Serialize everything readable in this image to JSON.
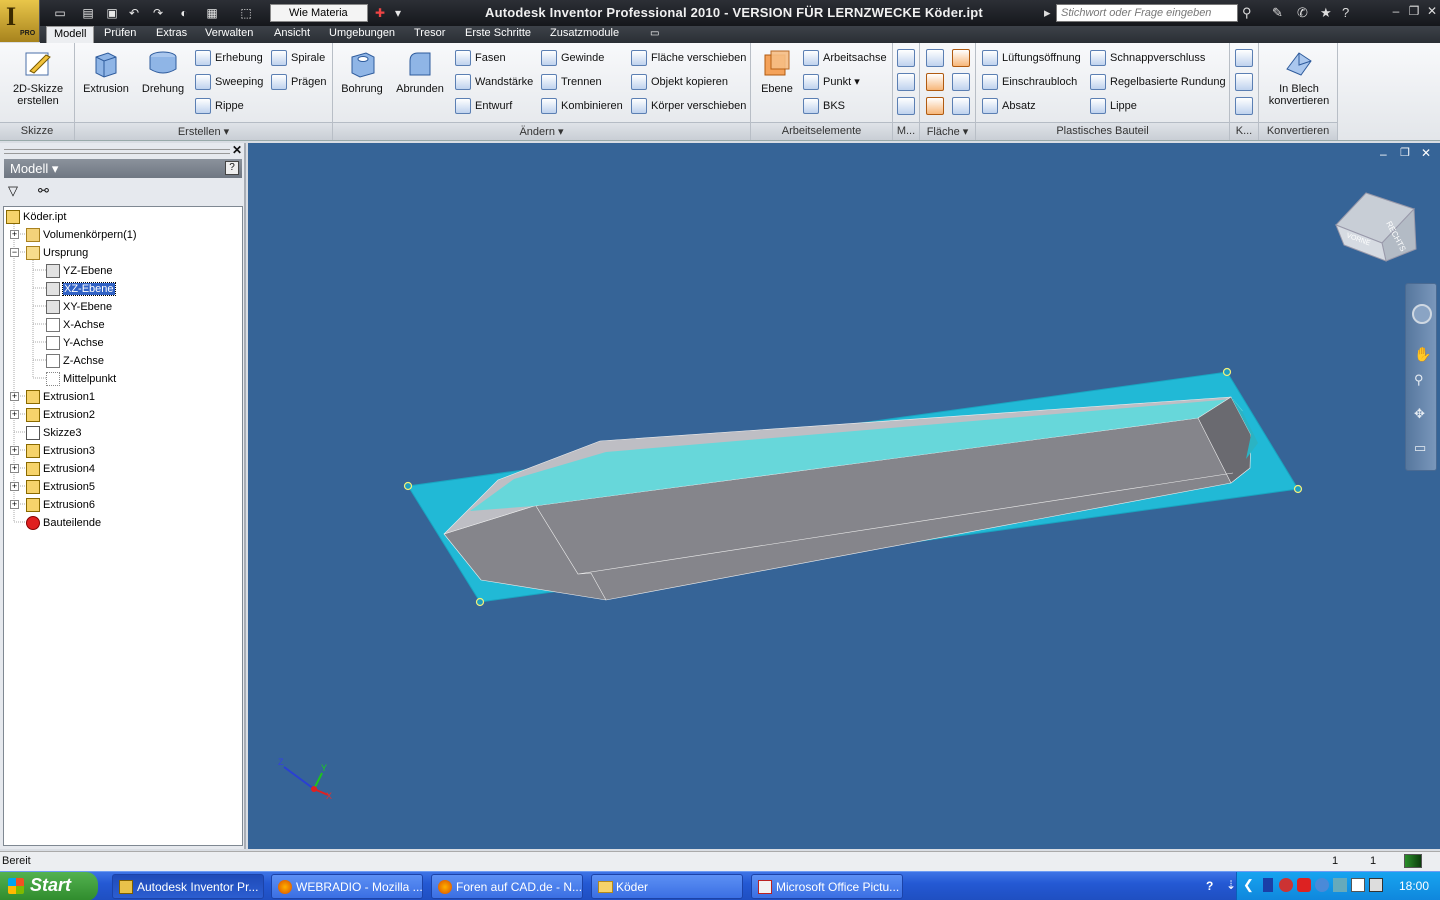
{
  "app": {
    "title": "Autodesk Inventor Professional 2010 - VERSION FÜR LERNZWECKE    Köder.ipt",
    "logo_letter": "I",
    "logo_badge": "PRO",
    "appearance": "Wie Materia",
    "search_placeholder": "Stichwort oder Frage eingeben"
  },
  "tabs": [
    "Modell",
    "Prüfen",
    "Extras",
    "Verwalten",
    "Ansicht",
    "Umgebungen",
    "Tresor",
    "Erste Schritte",
    "Zusatzmodule"
  ],
  "ribbon": {
    "skizze": {
      "button": "2D-Skizze erstellen",
      "title": "Skizze"
    },
    "erstellen": {
      "title": "Erstellen",
      "big": [
        "Extrusion",
        "Drehung"
      ],
      "small": [
        "Erhebung",
        "Sweeping",
        "Rippe",
        "Spirale",
        "Prägen"
      ]
    },
    "aendern": {
      "title": "Ändern",
      "big": [
        "Bohrung",
        "Abrunden"
      ],
      "small": [
        "Fasen",
        "Wandstärke",
        "Entwurf",
        "Gewinde",
        "Trennen",
        "Kombinieren",
        "Fläche verschieben",
        "Objekt kopieren",
        "Körper verschieben"
      ]
    },
    "arbeitselemente": {
      "title": "Arbeitselemente",
      "big": "Ebene",
      "small": [
        "Arbeitsachse",
        "Punkt",
        "BKS"
      ]
    },
    "m_title": "M...",
    "flaeche_title": "Fläche",
    "plastisch": {
      "title": "Plastisches Bauteil",
      "small": [
        "Lüftungsöffnung",
        "Einschraubloch",
        "Absatz",
        "Schnappverschluss",
        "Regelbasierte Rundung",
        "Lippe"
      ]
    },
    "k_title": "K...",
    "konvertieren": {
      "button": "In Blech konvertieren",
      "title": "Konvertieren"
    }
  },
  "browser": {
    "title": "Modell",
    "tree": [
      {
        "label": "Köder.ipt",
        "icon": "part-icon"
      },
      {
        "label": "Volumenkörpern(1)",
        "icon": "folder-icon"
      },
      {
        "label": "Ursprung",
        "icon": "folder-open-icon"
      },
      {
        "label": "YZ-Ebene",
        "icon": "plane-icon"
      },
      {
        "label": "XZ-Ebene",
        "icon": "plane-icon"
      },
      {
        "label": "XY-Ebene",
        "icon": "plane-icon"
      },
      {
        "label": "X-Achse",
        "icon": "axis-icon"
      },
      {
        "label": "Y-Achse",
        "icon": "axis-icon"
      },
      {
        "label": "Z-Achse",
        "icon": "axis-icon"
      },
      {
        "label": "Mittelpunkt",
        "icon": "point-icon"
      },
      {
        "label": "Extrusion1",
        "icon": "extrusion-icon"
      },
      {
        "label": "Extrusion2",
        "icon": "extrusion-icon"
      },
      {
        "label": "Skizze3",
        "icon": "sketch-icon"
      },
      {
        "label": "Extrusion3",
        "icon": "extrusion-icon"
      },
      {
        "label": "Extrusion4",
        "icon": "extrusion-icon"
      },
      {
        "label": "Extrusion5",
        "icon": "extrusion-icon"
      },
      {
        "label": "Extrusion6",
        "icon": "extrusion-icon"
      },
      {
        "label": "Bauteilende",
        "icon": "end-of-part-icon"
      }
    ],
    "selected": "XZ-Ebene"
  },
  "viewcube": {
    "face": "RECHTS",
    "face2": "VORNE"
  },
  "triad": {
    "x": "X",
    "y": "Y",
    "z": "Z"
  },
  "status": {
    "text": "Bereit",
    "count1": "1",
    "count2": "1"
  },
  "taskbar": {
    "start": "Start",
    "tasks": [
      "Autodesk Inventor Pr...",
      "WEBRADIO - Mozilla ...",
      "Foren auf CAD.de - N...",
      "Köder",
      "Microsoft Office Pictu..."
    ],
    "clock": "18:00"
  },
  "colors": {
    "viewport": "#366497",
    "plane": "#1fb7d4",
    "body": "#8a8a8f"
  }
}
